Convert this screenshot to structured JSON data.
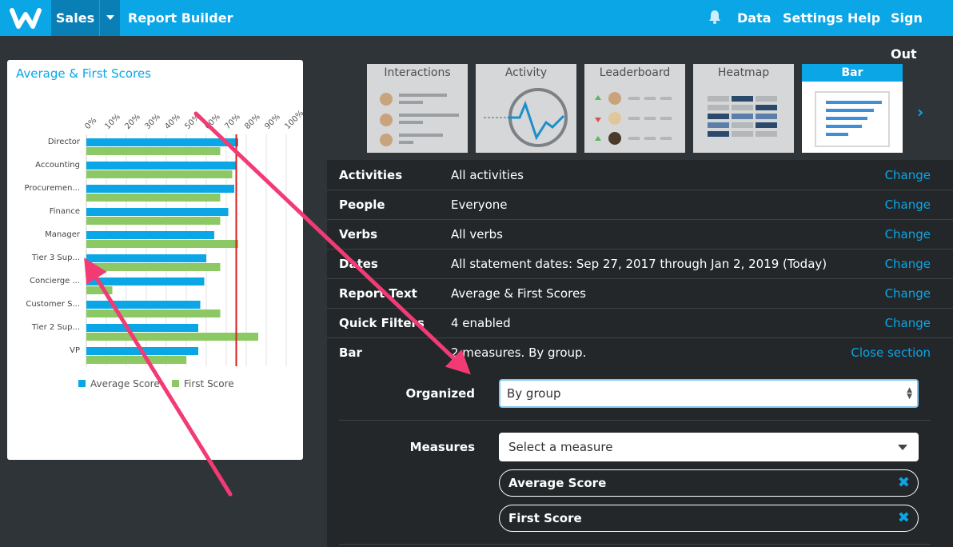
{
  "topbar": {
    "app": "Sales",
    "section": "Report Builder",
    "nav": [
      "Data",
      "Settings",
      "Help",
      "Sign Out"
    ]
  },
  "report_card": {
    "title": "Average & First Scores",
    "chart_data": {
      "type": "bar",
      "orientation": "horizontal",
      "categories": [
        "Director",
        "Accounting",
        "Procuremen...",
        "Finance",
        "Manager",
        "Tier 3 Sup...",
        "Concierge ...",
        "Customer S...",
        "Tier 2 Sup...",
        "VP"
      ],
      "series": [
        {
          "name": "Average Score",
          "color": "#0aa6e6",
          "values": [
            76,
            75,
            74,
            71,
            64,
            60,
            59,
            57,
            56,
            56
          ]
        },
        {
          "name": "First Score",
          "color": "#8cc864",
          "values": [
            67,
            73,
            67,
            67,
            76,
            67,
            13,
            67,
            86,
            50
          ]
        }
      ],
      "x_ticks": [
        "0%",
        "10%",
        "20%",
        "30%",
        "40%",
        "50%",
        "60%",
        "70%",
        "80%",
        "90%",
        "100%"
      ],
      "xlim": [
        0,
        100
      ],
      "reference_line": 75,
      "legend": "bottom",
      "grid": true
    }
  },
  "chart_types": [
    {
      "label": "Interactions",
      "active": false
    },
    {
      "label": "Activity",
      "active": false
    },
    {
      "label": "Leaderboard",
      "active": false
    },
    {
      "label": "Heatmap",
      "active": false
    },
    {
      "label": "Bar",
      "active": true
    }
  ],
  "settings": [
    {
      "key": "Activities",
      "value": "All activities",
      "action": "Change"
    },
    {
      "key": "People",
      "value": "Everyone",
      "action": "Change"
    },
    {
      "key": "Verbs",
      "value": "All verbs",
      "action": "Change"
    },
    {
      "key": "Dates",
      "value": "All statement dates: Sep 27, 2017 through Jan 2, 2019 (Today)",
      "action": "Change"
    },
    {
      "key": "Report Text",
      "value": "Average & First Scores",
      "action": "Change"
    },
    {
      "key": "Quick Filters",
      "value": "4 enabled",
      "action": "Change"
    },
    {
      "key": "Bar",
      "value": "2 measures. By group.",
      "action": "Close section"
    }
  ],
  "bar_section": {
    "organized_label": "Organized",
    "organized_value": "By group",
    "measures_label": "Measures",
    "measures_placeholder": "Select a measure",
    "measures": [
      "Average Score",
      "First Score"
    ]
  },
  "colors": {
    "brand": "#0aa6e6",
    "average": "#0aa6e6",
    "first": "#8cc864",
    "annotation_arrow": "#f23b74"
  }
}
